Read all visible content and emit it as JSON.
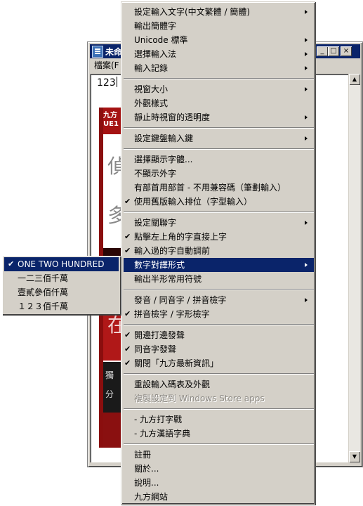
{
  "window": {
    "title": "未命",
    "menu_label": "檔案(F",
    "input_value": "123",
    "minimize": "_",
    "maximize": "□",
    "close": "×",
    "scroll_up": "▲",
    "scroll_down": "▼"
  },
  "banner": {
    "logo_line1": "九方",
    "logo_line2": "UE1",
    "glyph1": "偵",
    "glyph2": "多",
    "glyph3": "在",
    "text1": "獨",
    "text2": "分"
  },
  "menu": {
    "check_mark": "✔",
    "items": [
      {
        "label": "設定輸入文字(中文繁體 / 簡體)",
        "checked": false,
        "submenu": true
      },
      {
        "label": "輸出簡體字",
        "checked": false,
        "submenu": false
      },
      {
        "label": "Unicode 標準",
        "checked": false,
        "submenu": true
      },
      {
        "label": "選擇輸入法",
        "checked": false,
        "submenu": true
      },
      {
        "label": "輸入記錄",
        "checked": false,
        "submenu": true
      },
      {
        "label": "視窗大小",
        "checked": false,
        "submenu": true
      },
      {
        "label": "外觀樣式",
        "checked": false,
        "submenu": false
      },
      {
        "label": "靜止時視窗的透明度",
        "checked": false,
        "submenu": true
      },
      {
        "label": "設定鍵盤輸入鍵",
        "checked": false,
        "submenu": true
      },
      {
        "label": "選擇顯示字體...",
        "checked": false,
        "submenu": false
      },
      {
        "label": "不顯示外字",
        "checked": false,
        "submenu": false
      },
      {
        "label": "有部首用部首 - 不用兼容碼（筆劃輸入）",
        "checked": false,
        "submenu": false
      },
      {
        "label": "使用舊版輸入排位（字型輸入）",
        "checked": true,
        "submenu": false
      },
      {
        "label": "設定關聯字",
        "checked": false,
        "submenu": true
      },
      {
        "label": "點擊左上角的字直接上字",
        "checked": true,
        "submenu": false
      },
      {
        "label": "輸入過的字自動調前",
        "checked": true,
        "submenu": false
      },
      {
        "label": "數字對譯形式",
        "checked": false,
        "submenu": true
      },
      {
        "label": "輸出半形常用符號",
        "checked": false,
        "submenu": false
      },
      {
        "label": "發音 / 同音字 / 拼音檢字",
        "checked": false,
        "submenu": true
      },
      {
        "label": "拼音檢字 / 字形檢字",
        "checked": true,
        "submenu": false
      },
      {
        "label": "開邊打邊發聲",
        "checked": true,
        "submenu": false
      },
      {
        "label": "同音字發聲",
        "checked": true,
        "submenu": false
      },
      {
        "label": "關閉「九方最新資訊」",
        "checked": true,
        "submenu": false
      },
      {
        "label": "重設輸入碼表及外觀",
        "checked": false,
        "submenu": false
      },
      {
        "label": "複製設定到 Windows Store apps",
        "checked": false,
        "submenu": false
      },
      {
        "label": "- 九方打字戰",
        "checked": false,
        "submenu": false
      },
      {
        "label": "- 九方漢語字典",
        "checked": false,
        "submenu": false
      },
      {
        "label": "註冊",
        "checked": false,
        "submenu": false
      },
      {
        "label": "關於...",
        "checked": false,
        "submenu": false
      },
      {
        "label": "說明...",
        "checked": false,
        "submenu": false
      },
      {
        "label": "九方網站",
        "checked": false,
        "submenu": false
      }
    ]
  },
  "submenu": {
    "items": [
      {
        "label": "ONE TWO HUNDRED",
        "checked": true
      },
      {
        "label": "一二三佰千萬",
        "checked": false
      },
      {
        "label": "壹貳參佰仟萬",
        "checked": false
      },
      {
        "label": "１２３佰千萬",
        "checked": false
      }
    ]
  },
  "colors": {
    "highlight": "#0a246a",
    "menu_face": "#d4d0c8",
    "disabled_text": "#8d8a84"
  }
}
